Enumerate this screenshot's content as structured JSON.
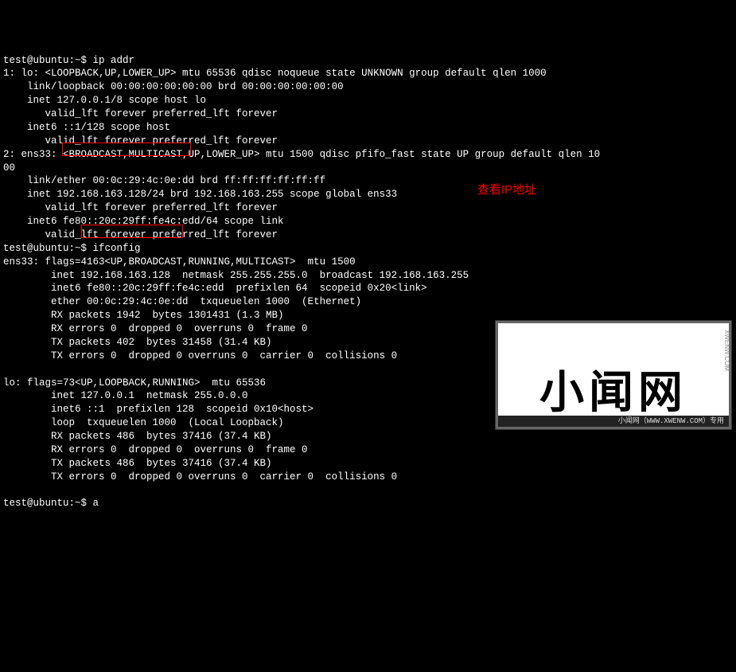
{
  "lines": [
    "test@ubuntu:~$ ip addr",
    "1: lo: <LOOPBACK,UP,LOWER_UP> mtu 65536 qdisc noqueue state UNKNOWN group default qlen 1000",
    "    link/loopback 00:00:00:00:00:00 brd 00:00:00:00:00:00",
    "    inet 127.0.0.1/8 scope host lo",
    "       valid_lft forever preferred_lft forever",
    "    inet6 ::1/128 scope host",
    "       valid_lft forever preferred_lft forever",
    "2: ens33: <BROADCAST,MULTICAST,UP,LOWER_UP> mtu 1500 qdisc pfifo_fast state UP group default qlen 10",
    "00",
    "    link/ether 00:0c:29:4c:0e:dd brd ff:ff:ff:ff:ff:ff",
    "    inet 192.168.163.128/24 brd 192.168.163.255 scope global ens33",
    "       valid_lft forever preferred_lft forever",
    "    inet6 fe80::20c:29ff:fe4c:edd/64 scope link",
    "       valid_lft forever preferred_lft forever",
    "test@ubuntu:~$ ifconfig",
    "ens33: flags=4163<UP,BROADCAST,RUNNING,MULTICAST>  mtu 1500",
    "        inet 192.168.163.128  netmask 255.255.255.0  broadcast 192.168.163.255",
    "        inet6 fe80::20c:29ff:fe4c:edd  prefixlen 64  scopeid 0x20<link>",
    "        ether 00:0c:29:4c:0e:dd  txqueuelen 1000  (Ethernet)",
    "        RX packets 1942  bytes 1301431 (1.3 MB)",
    "        RX errors 0  dropped 0  overruns 0  frame 0",
    "        TX packets 402  bytes 31458 (31.4 KB)",
    "        TX errors 0  dropped 0 overruns 0  carrier 0  collisions 0",
    "",
    "lo: flags=73<UP,LOOPBACK,RUNNING>  mtu 65536",
    "        inet 127.0.0.1  netmask 255.0.0.0",
    "        inet6 ::1  prefixlen 128  scopeid 0x10<host>",
    "        loop  txqueuelen 1000  (Local Loopback)",
    "        RX packets 486  bytes 37416 (37.4 KB)",
    "        RX errors 0  dropped 0  overruns 0  frame 0",
    "        TX packets 486  bytes 37416 (37.4 KB)",
    "        TX errors 0  dropped 0 overruns 0  carrier 0  collisions 0",
    "",
    "test@ubuntu:~$ a"
  ],
  "annotation": "查看IP地址",
  "highlighted_ips": [
    "192.168.163.128/24",
    "192.168.163.128"
  ],
  "watermark": {
    "big": "小闻网",
    "url": "XWENW.COM",
    "bar": "小闻网（WWW.XWENW.COM）专用"
  }
}
